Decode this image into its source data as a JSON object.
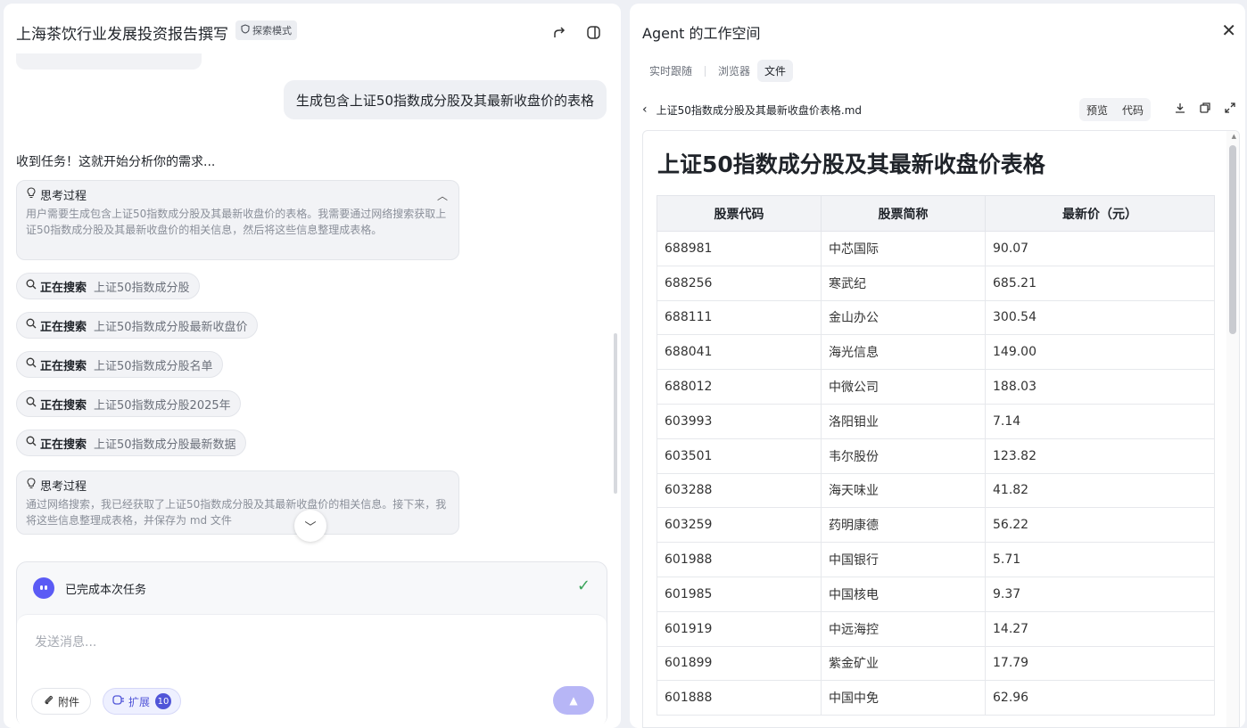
{
  "chat": {
    "title": "上海茶饮行业发展投资报告撰写",
    "mode_badge": "探索模式",
    "user_message": "生成包含上证50指数成分股及其最新收盘价的表格",
    "ack": "收到任务！这就开始分析你的需求...",
    "think1": {
      "label": "思考过程",
      "body": "用户需要生成包含上证50指数成分股及其最新收盘价的表格。我需要通过网络搜索获取上证50指数成分股及其最新收盘价的相关信息，然后将这些信息整理成表格。"
    },
    "searches": [
      {
        "status": "正在搜索",
        "query": "上证50指数成分股"
      },
      {
        "status": "正在搜索",
        "query": "上证50指数成分股最新收盘价"
      },
      {
        "status": "正在搜索",
        "query": "上证50指数成分股名单"
      },
      {
        "status": "正在搜索",
        "query": "上证50指数成分股2025年"
      },
      {
        "status": "正在搜索",
        "query": "上证50指数成分股最新数据"
      }
    ],
    "think2": {
      "label": "思考过程",
      "body": "通过网络搜索，我已经获取了上证50指数成分股及其最新收盘价的相关信息。接下来，我将这些信息整理成表格，并保存为 md 文件"
    },
    "done_text": "已完成本次任务",
    "input_placeholder": "发送消息...",
    "attach_label": "附件",
    "extend_label": "扩展",
    "extend_count": "10"
  },
  "workspace": {
    "title": "Agent 的工作空间",
    "tabs": [
      "实时跟随",
      "浏览器",
      "文件"
    ],
    "active_tab": 2,
    "file_name": "上证50指数成分股及其最新收盘价表格.md",
    "view_modes": [
      "预览",
      "代码"
    ],
    "doc_title": "上证50指数成分股及其最新收盘价表格",
    "table": {
      "headers": [
        "股票代码",
        "股票简称",
        "最新价（元）"
      ],
      "rows": [
        [
          "688981",
          "中芯国际",
          "90.07"
        ],
        [
          "688256",
          "寒武纪",
          "685.21"
        ],
        [
          "688111",
          "金山办公",
          "300.54"
        ],
        [
          "688041",
          "海光信息",
          "149.00"
        ],
        [
          "688012",
          "中微公司",
          "188.03"
        ],
        [
          "603993",
          "洛阳钼业",
          "7.14"
        ],
        [
          "603501",
          "韦尔股份",
          "123.82"
        ],
        [
          "603288",
          "海天味业",
          "41.82"
        ],
        [
          "603259",
          "药明康德",
          "56.22"
        ],
        [
          "601988",
          "中国银行",
          "5.71"
        ],
        [
          "601985",
          "中国核电",
          "9.37"
        ],
        [
          "601919",
          "中远海控",
          "14.27"
        ],
        [
          "601899",
          "紫金矿业",
          "17.79"
        ],
        [
          "601888",
          "中国中免",
          "62.96"
        ]
      ]
    }
  },
  "colors": {
    "accent": "#5055d8",
    "send_button": "#b7b6f6",
    "success": "#3aa45a"
  },
  "icons": {
    "share": "share-icon",
    "sidebar_toggle": "panel-toggle-icon",
    "close": "close-icon",
    "download": "download-icon",
    "copy": "copy-icon",
    "expand": "expand-icon"
  }
}
